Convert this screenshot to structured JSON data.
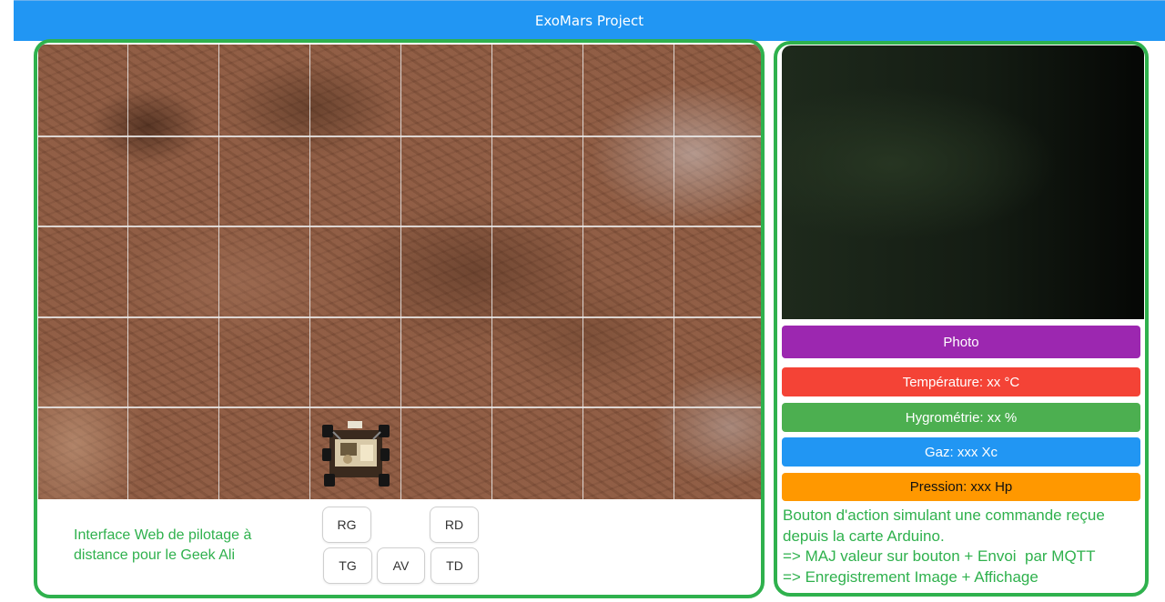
{
  "header": {
    "title": "ExoMars Project"
  },
  "map": {
    "grid_columns": 8,
    "grid_rows": 5
  },
  "caption": "Interface Web de pilotage à distance pour le Geek Ali",
  "controls": {
    "rg": "RG",
    "rd": "RD",
    "tg": "TG",
    "av": "AV",
    "td": "TD"
  },
  "actions": {
    "photo": "Photo",
    "temperature": "Température: xx °C",
    "hygrometrie": "Hygrométrie: xx %",
    "gaz": "Gaz: xxx Xc",
    "pression": "Pression: xxx Hp"
  },
  "info_lines": [
    "Bouton d'action simulant une commande reçue",
    "depuis la carte Arduino.",
    "=> MAJ valeur sur bouton + Envoi  par MQTT",
    "=> Enregistrement Image + Affichage"
  ],
  "colors": {
    "header": "#2196f3",
    "frame": "#2fb14d",
    "photo": "#9c27b0",
    "temperature": "#f44336",
    "hygrometrie": "#4caf50",
    "gaz": "#2196f3",
    "pression": "#ff9800"
  },
  "icons": {
    "rover": "rover-icon"
  }
}
